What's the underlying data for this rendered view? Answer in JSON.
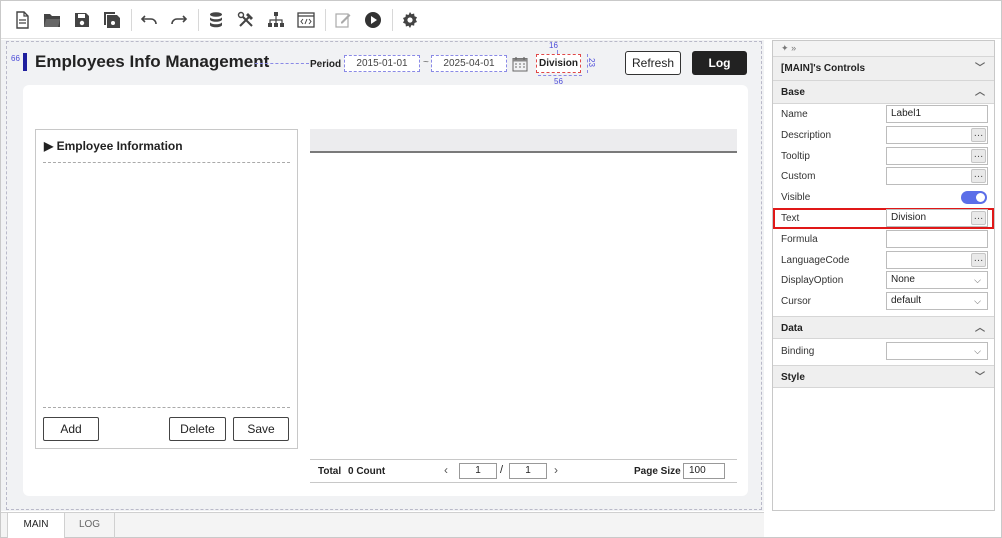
{
  "toolbar": {
    "buttons": [
      "new-file-icon",
      "open-folder-icon",
      "save-icon",
      "save-all-icon",
      "undo-icon",
      "redo-icon",
      "database-icon",
      "tools-icon",
      "hierarchy-icon",
      "code-icon",
      "edit-icon",
      "run-icon",
      "settings-icon"
    ]
  },
  "designer": {
    "title": "Employees Info Management",
    "guide_left": "66",
    "period_label": "Period",
    "date_from": "2015-01-01",
    "tilde": "~",
    "date_to": "2025-04-01",
    "division": "Division",
    "division_top": "16",
    "division_right": "23",
    "division_bottom": "56",
    "refresh_label": "Refresh",
    "log_label": "Log"
  },
  "employee_panel": {
    "title": "Employee Information",
    "add_label": "Add",
    "delete_label": "Delete",
    "save_label": "Save"
  },
  "grid": {
    "total_label": "Total",
    "count_text": "0 Count",
    "page_current": "1",
    "page_separator": "/",
    "page_total": "1",
    "page_size_label": "Page Size",
    "page_size": "100"
  },
  "tabs": [
    {
      "label": "MAIN",
      "active": true
    },
    {
      "label": "LOG",
      "active": false
    }
  ],
  "properties": {
    "header": "[MAIN]'s Controls",
    "base_section": "Base",
    "rows": [
      {
        "label": "Name",
        "value": "Label1"
      },
      {
        "label": "Description",
        "value": ""
      },
      {
        "label": "Tooltip",
        "value": ""
      },
      {
        "label": "Custom",
        "value": ""
      },
      {
        "label": "Visible",
        "value": ""
      },
      {
        "label": "Text",
        "value": "Division"
      },
      {
        "label": "Formula",
        "value": ""
      },
      {
        "label": "LanguageCode",
        "value": ""
      },
      {
        "label": "DisplayOption",
        "value": "None"
      },
      {
        "label": "Cursor",
        "value": "default"
      }
    ],
    "data_section": "Data",
    "binding_label": "Binding",
    "binding_value": "",
    "style_section": "Style"
  },
  "colors": {
    "accent": "#5b6ee8",
    "highlight": "#e01818",
    "title_bar": "#1f1f9e"
  }
}
